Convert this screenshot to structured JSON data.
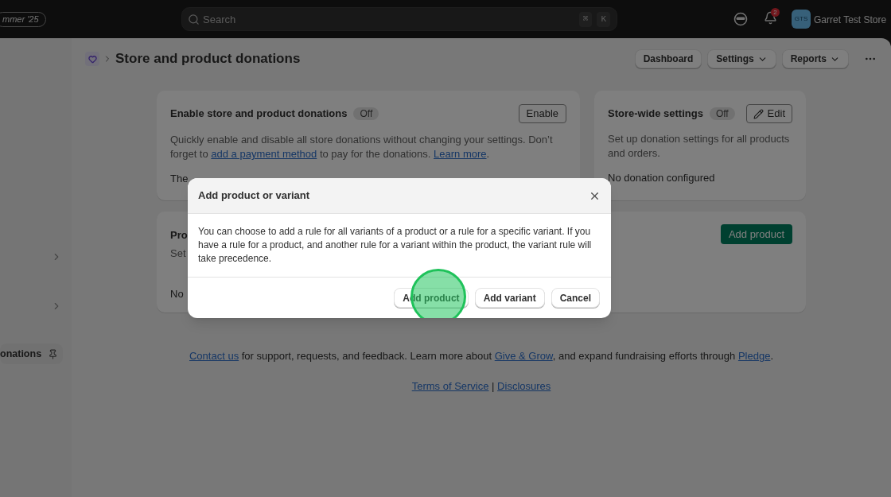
{
  "top_bar": {
    "edition_badge": "mmer '25",
    "search": {
      "placeholder": "Search",
      "shortcut_keys": [
        "⌘",
        "K"
      ]
    },
    "notifications": {
      "count": "2"
    },
    "store": {
      "initials": "GTS",
      "name": "Garret Test Store"
    }
  },
  "sidebar": {
    "pinned_item": {
      "label": "onations"
    }
  },
  "page_header": {
    "title": "Store and product donations",
    "actions": [
      {
        "label": "Dashboard",
        "dropdown": false
      },
      {
        "label": "Settings",
        "dropdown": true
      },
      {
        "label": "Reports",
        "dropdown": true
      }
    ]
  },
  "enable_card": {
    "title": "Enable store and product donations",
    "status": "Off",
    "button": "Enable",
    "description": [
      {
        "kind": "text",
        "text": "Quickly enable and disable all store donations without changing your settings. Don’t forget to "
      },
      {
        "kind": "link",
        "text": "add a payment method"
      },
      {
        "kind": "text",
        "text": " to pay for the donations. "
      },
      {
        "kind": "link",
        "text": "Learn more"
      },
      {
        "kind": "text",
        "text": "."
      }
    ],
    "note": "The"
  },
  "store_wide_card": {
    "title": "Store-wide settings",
    "status": "Off",
    "button": "Edit",
    "description": "Set up donation settings for all products and orders.",
    "value": "No donation configured"
  },
  "products_card": {
    "title": "Pro",
    "subtitle": "Set",
    "empty_text": "No",
    "button": "Add product"
  },
  "footer": {
    "lines": [
      [
        {
          "kind": "link",
          "text": "Contact us"
        },
        {
          "kind": "text",
          "text": " for support, requests, and feedback. Learn more about "
        },
        {
          "kind": "link",
          "text": "Give & Grow"
        },
        {
          "kind": "text",
          "text": ", and expand fundraising efforts through "
        },
        {
          "kind": "link",
          "text": "Pledge"
        },
        {
          "kind": "text",
          "text": "."
        }
      ],
      [
        {
          "kind": "link",
          "text": "Terms of Service"
        },
        {
          "kind": "text",
          "text": " | "
        },
        {
          "kind": "link",
          "text": "Disclosures"
        }
      ]
    ]
  },
  "dialog": {
    "title": "Add product or variant",
    "body": "You can choose to add a rule for all variants of a product or a rule for a specific variant. If you have a rule for a product, and another rule for a variant within the product, the variant rule will take precedence.",
    "buttons": [
      {
        "label": "Add product",
        "clicked": true
      },
      {
        "label": "Add variant",
        "clicked": false
      },
      {
        "label": "Cancel",
        "clicked": false
      }
    ]
  }
}
